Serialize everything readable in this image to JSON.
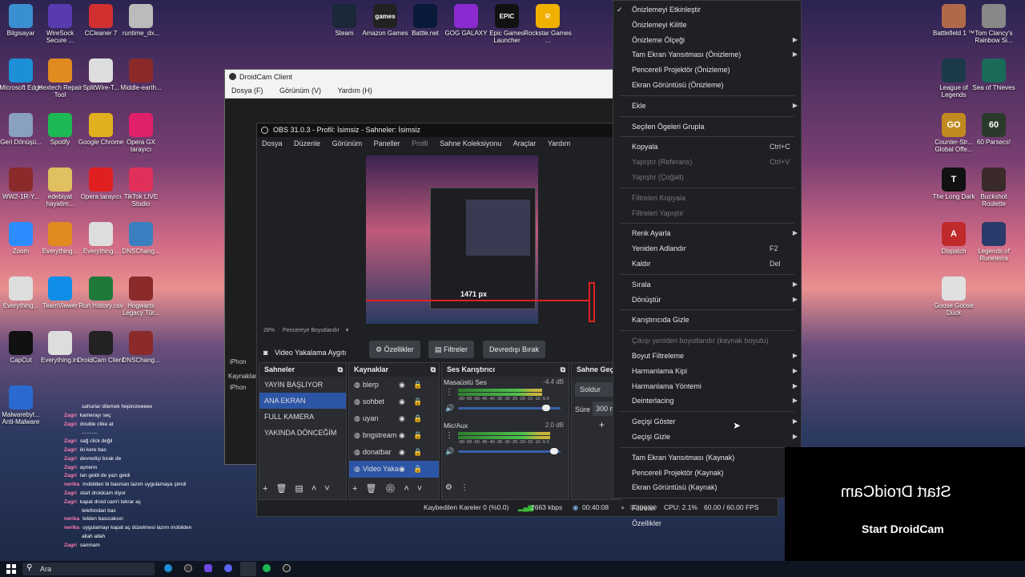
{
  "desktop_icons_left": [
    {
      "label": "Bilgisayar",
      "color": "#3a8fd0"
    },
    {
      "label": "WireSock Secure ...",
      "color": "#5a3ab0"
    },
    {
      "label": "CCleaner 7",
      "color": "#d03030"
    },
    {
      "label": "runtime_dx...",
      "color": "#bbbbbb"
    },
    {
      "label": "Microsoft Edge",
      "color": "#1c8fd6"
    },
    {
      "label": "Hextech Repair Tool",
      "color": "#e08a20"
    },
    {
      "label": "SplitWire-T...",
      "color": "#dddddd"
    },
    {
      "label": "Middle-earth...",
      "color": "#8a2a2a"
    },
    {
      "label": "Geri Dönüşü...",
      "color": "#8aa0c0"
    },
    {
      "label": "Spotify",
      "color": "#1db954"
    },
    {
      "label": "Google Chrome",
      "color": "#e0b020"
    },
    {
      "label": "Opera GX tarayıcı",
      "color": "#e0206a"
    },
    {
      "label": "WW2-1R-Y...",
      "color": "#8a2a2a"
    },
    {
      "label": "edebiyat hayatim...",
      "color": "#e0c060"
    },
    {
      "label": "Opera tarayıcı",
      "color": "#e02020"
    },
    {
      "label": "TikTok LIVE Studio",
      "color": "#e0305a"
    },
    {
      "label": "Zoom",
      "color": "#2d8cff"
    },
    {
      "label": "Everything...",
      "color": "#e08a20"
    },
    {
      "label": "Everything...",
      "color": "#dddddd"
    },
    {
      "label": "DNSChang...",
      "color": "#3a80c0"
    },
    {
      "label": "Everything...",
      "color": "#dddddd"
    },
    {
      "label": "TeamViewer",
      "color": "#0e8ee9"
    },
    {
      "label": "Run History.csv",
      "color": "#1f7a3a"
    },
    {
      "label": "Hogwarts Legacy Tür...",
      "color": "#8a2a2a"
    },
    {
      "label": "CapCut",
      "color": "#111111"
    },
    {
      "label": "Everything.ini",
      "color": "#dddddd"
    },
    {
      "label": "DroidCam Client",
      "color": "#222222"
    },
    {
      "label": "DNSChang...",
      "color": "#8a2a2a"
    },
    {
      "label": "Malwarebyt... Anti-Malware",
      "color": "#2a6ad0"
    }
  ],
  "desktop_icons_top": [
    {
      "label": "Steam",
      "color": "#1b2838"
    },
    {
      "label": "Amazon Games",
      "color": "#222222",
      "glyph": "games"
    },
    {
      "label": "Battle.net",
      "color": "#0a1a3a"
    },
    {
      "label": "GOG GALAXY",
      "color": "#8a2ad0"
    },
    {
      "label": "Epic Games Launcher",
      "color": "#111111",
      "glyph": "EPIC"
    },
    {
      "label": "Rockstar Games ...",
      "color": "#f0b000",
      "glyph": "R"
    }
  ],
  "desktop_icons_right": [
    {
      "label": "Battlefield 1 ™",
      "color": "#b06a4a"
    },
    {
      "label": "Tom Clancy's Rainbow Si...",
      "color": "#888888"
    },
    {
      "label": "League of Legends",
      "color": "#1a3a4a"
    },
    {
      "label": "Sea of Thieves",
      "color": "#1a6a5a"
    },
    {
      "label": "Counter-Str... Global Offe...",
      "color": "#c08a20",
      "glyph": "GO"
    },
    {
      "label": "60 Parsecs!",
      "color": "#2a3a2a",
      "glyph": "60"
    },
    {
      "label": "The Long Dark",
      "color": "#111111",
      "glyph": "T"
    },
    {
      "label": "Buckshot Roulette",
      "color": "#3a2a2a"
    },
    {
      "label": "Dispatch",
      "color": "#c02a2a",
      "glyph": "A"
    },
    {
      "label": "Legends of Runeterra",
      "color": "#2a3a6a"
    },
    {
      "label": "Goose Goose Duck",
      "color": "#e0e0e0"
    }
  ],
  "droidcam": {
    "title": "DroidCam Client",
    "menu": [
      "Dosya (F)",
      "Görünüm (V)",
      "Yardım (H)"
    ],
    "side_labels": [
      "iPhon",
      "Kaynaklar",
      "iPhon"
    ]
  },
  "obs": {
    "title": "OBS 31.0.3 - Profil: İsimsiz - Sahneler: İsimsiz",
    "menu": [
      "Dosya",
      "Düzenle",
      "Görünüm",
      "Paneller",
      "Profil",
      "Sahne Koleksiyonu",
      "Araçlar",
      "Yardım"
    ],
    "preview_size_label": "1471 px",
    "zoom": "28%",
    "zoom_mode": "Pencereye Boyutlandır",
    "source_bar": {
      "name": "Video Yakalama Aygıtı",
      "properties": "Özellikler",
      "filters": "Filtreler",
      "deactivate": "Devredışı Bırak"
    },
    "scenes": {
      "header": "Sahneler",
      "items": [
        "YAYIN BAŞLIYOR",
        "ANA EKRAN",
        "FULL KAMERA",
        "YAKINDA DÖNCEĞİM"
      ]
    },
    "sources": {
      "header": "Kaynaklar",
      "items": [
        "blerp",
        "sohbet",
        "uyarı",
        "bngstream",
        "donatbar",
        "Video Yaka"
      ]
    },
    "mixer": {
      "header": "Ses Karıştırıcı",
      "channels": [
        {
          "name": "Masaüstü Ses",
          "db": "-4.4 dB",
          "level": 0.82
        },
        {
          "name": "Mic/Aux",
          "db": "2.0 dB",
          "level": 0.9
        }
      ],
      "scale": "-60 -55 -50 -45 -40 -35 -30 -25 -20 -15 -10 -5 0"
    },
    "transitions": {
      "header": "Sahne Geçi",
      "type": "Soldur",
      "duration_label": "Süre",
      "duration": "300 m"
    },
    "status": {
      "dropped": "Kaybedilen Kareler 0 (%0.0)",
      "bitrate": "2663 kbps",
      "stream_time": "00:40:08",
      "rec_time": "00:00:00",
      "cpu": "CPU: 2.1%",
      "fps": "60.00 / 60.00 FPS"
    }
  },
  "context_menu": [
    {
      "label": "Önizlemeyi Etkinleştir",
      "checked": true
    },
    {
      "label": "Önizlemeyi Kilitle"
    },
    {
      "label": "Önizleme Ölçeği",
      "submenu": true
    },
    {
      "label": "Tam Ekran Yansıtması (Önizleme)",
      "submenu": true
    },
    {
      "label": "Pencereli Projektör (Önizleme)"
    },
    {
      "label": "Ekran Görüntüsü (Önizleme)"
    },
    {
      "sep": true
    },
    {
      "label": "Ekle",
      "submenu": true
    },
    {
      "sep": true
    },
    {
      "label": "Seçilen Ögeleri Grupla"
    },
    {
      "sep": true
    },
    {
      "label": "Kopyala",
      "shortcut": "Ctrl+C"
    },
    {
      "label": "Yapıştır (Referans)",
      "shortcut": "Ctrl+V",
      "disabled": true
    },
    {
      "label": "Yapıştır (Çoğalt)",
      "disabled": true
    },
    {
      "sep": true
    },
    {
      "label": "Filtreleri Kopyala",
      "disabled": true
    },
    {
      "label": "Filtreleri Yapıştır",
      "disabled": true
    },
    {
      "sep": true
    },
    {
      "label": "Renk Ayarla",
      "submenu": true
    },
    {
      "label": "Yeniden Adlandır",
      "shortcut": "F2"
    },
    {
      "label": "Kaldır",
      "shortcut": "Del"
    },
    {
      "sep": true
    },
    {
      "label": "Sırala",
      "submenu": true
    },
    {
      "label": "Dönüştür",
      "submenu": true
    },
    {
      "sep": true
    },
    {
      "label": "Karıştırıcıda Gizle"
    },
    {
      "sep": true
    },
    {
      "label": "Çıkışı yeniden boyutlandır (kaynak boyutu)",
      "disabled": true
    },
    {
      "label": "Boyut Filtreleme",
      "submenu": true
    },
    {
      "label": "Harmanlama Kipi",
      "submenu": true
    },
    {
      "label": "Harmanlama Yöntemi",
      "submenu": true
    },
    {
      "label": "Deinterlacing",
      "submenu": true
    },
    {
      "sep": true
    },
    {
      "label": "Geçişi Göster",
      "submenu": true
    },
    {
      "label": "Geçişi Gizle",
      "submenu": true
    },
    {
      "sep": true
    },
    {
      "label": "Tam Ekran Yansıtması (Kaynak)",
      "submenu": true
    },
    {
      "label": "Pencereli Projektör (Kaynak)"
    },
    {
      "label": "Ekran Görüntüsü (Kaynak)"
    },
    {
      "sep": true
    },
    {
      "label": "Filtreler"
    },
    {
      "label": "Özellikler"
    }
  ],
  "droidcam_panel": {
    "mirrored_text": "Start DroidCam",
    "button_text": "Start DroidCam"
  },
  "chat": [
    {
      "user": "",
      "msg": "sahurlar dilemek hepinizeeeee"
    },
    {
      "user": "Zagri",
      "msg": "kamerayı seç"
    },
    {
      "user": "Zagri",
      "msg": "double clike at"
    },
    {
      "user": "",
      "msg": "..........."
    },
    {
      "user": "Zagri",
      "msg": "sağ click değil"
    },
    {
      "user": "Zagri",
      "msg": "iki kere bas"
    },
    {
      "user": "Zagri",
      "msg": "devredişi bırak de"
    },
    {
      "user": "Zagri",
      "msg": "aynenn"
    },
    {
      "user": "Zagri",
      "msg": "lan geldi de yazı geldi"
    },
    {
      "user": "nerika",
      "msg": "mobilden bi basman lazım uygulamaya şimdi"
    },
    {
      "user": "Zagri",
      "msg": "start droidcam diyor"
    },
    {
      "user": "Zagri",
      "msg": "kapat droid cam'i tekrar aç"
    },
    {
      "user": "",
      "msg": "telefondan bas"
    },
    {
      "user": "nerika",
      "msg": "telden basıcaksın"
    },
    {
      "user": "nerika",
      "msg": "uygulamayı kapat aç düzelmesi lazım mobilden"
    },
    {
      "user": "",
      "msg": "allah allah"
    },
    {
      "user": "Zagri",
      "msg": "sanmam"
    }
  ],
  "taskbar": {
    "search_placeholder": "Ara"
  }
}
